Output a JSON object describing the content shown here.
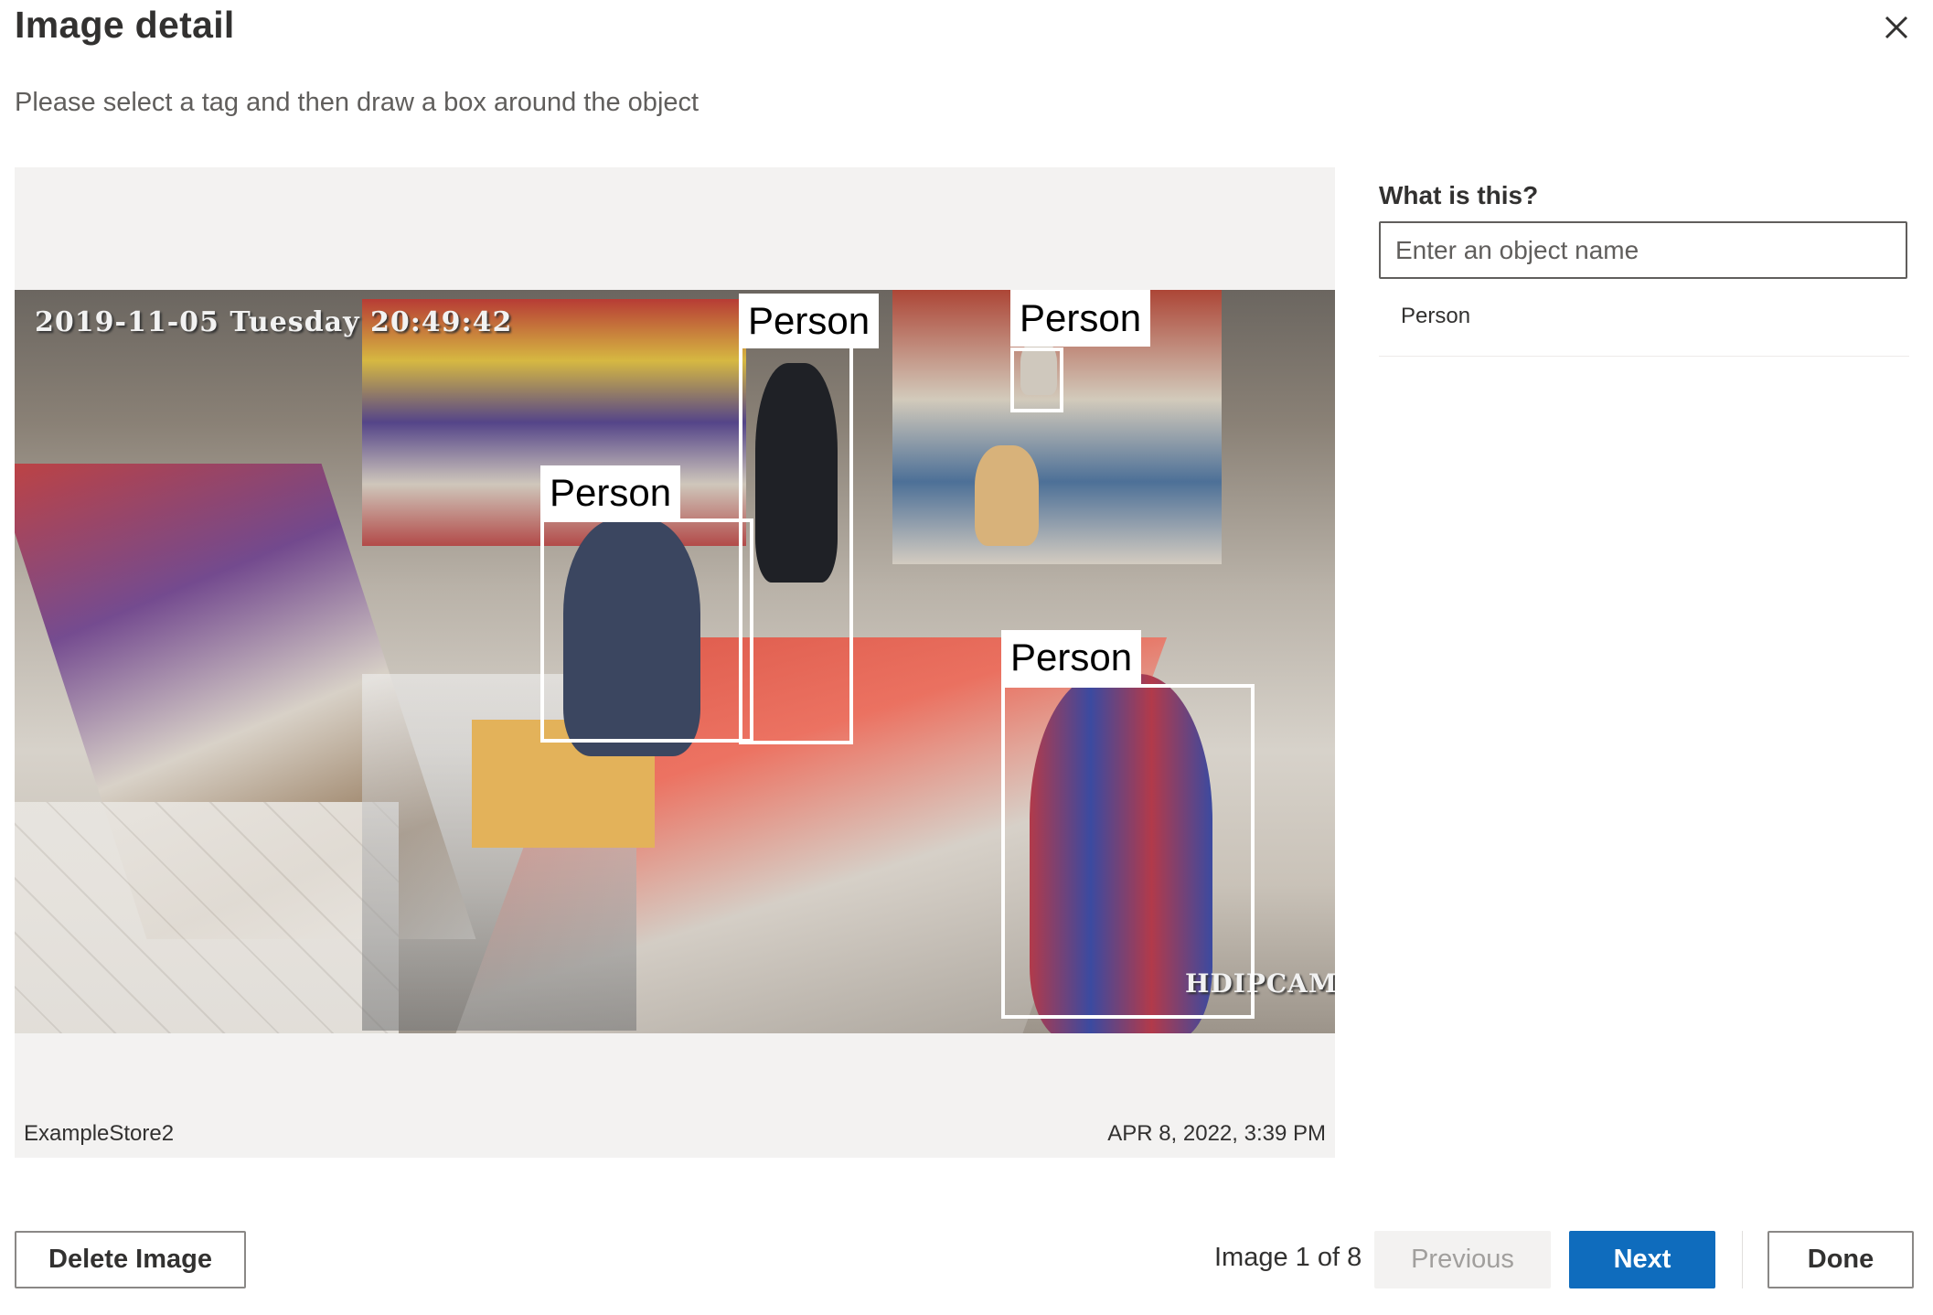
{
  "dialog": {
    "title": "Image detail",
    "subtitle": "Please select a tag and then draw a box around the object",
    "close_icon": "close-icon"
  },
  "image": {
    "source_name": "ExampleStore2",
    "timestamp": "APR 8, 2022, 3:39 PM",
    "overlay_datetime": "2019-11-05  Tuesday  20:49:42",
    "overlay_watermark": "HDIPCAM",
    "boxes": [
      {
        "label": "Person"
      },
      {
        "label": "Person"
      },
      {
        "label": "Person"
      },
      {
        "label": "Person"
      }
    ]
  },
  "tag_panel": {
    "heading": "What is this?",
    "input_placeholder": "Enter an object name",
    "input_value": "",
    "tags": [
      "Person"
    ]
  },
  "footer": {
    "delete_label": "Delete Image",
    "pager_text": "Image 1 of 8",
    "previous_label": "Previous",
    "next_label": "Next",
    "done_label": "Done",
    "accent_color": "#0f6cbd"
  }
}
